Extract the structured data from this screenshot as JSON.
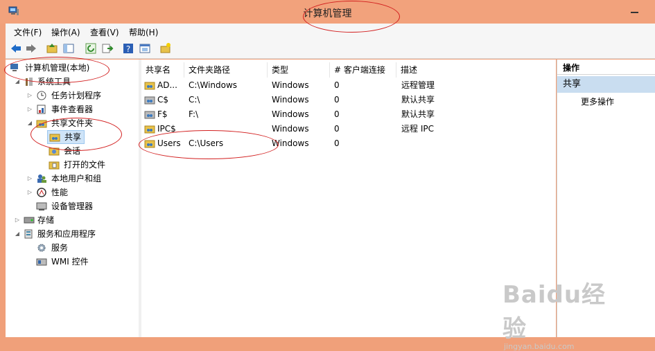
{
  "window": {
    "title": "计算机管理"
  },
  "menu": [
    "文件(F)",
    "操作(A)",
    "查看(V)",
    "帮助(H)"
  ],
  "toolbar_icons": [
    "back-arrow-icon",
    "forward-arrow-icon",
    "up-folder-icon",
    "show-hide-tree-icon",
    "refresh-icon",
    "export-list-icon",
    "help-icon",
    "properties-icon",
    "new-share-icon"
  ],
  "tree": {
    "root": "计算机管理(本地)",
    "system_tools": "系统工具",
    "task_scheduler": "任务计划程序",
    "event_viewer": "事件查看器",
    "shared_folders": "共享文件夹",
    "shares": "共享",
    "sessions": "会话",
    "open_files": "打开的文件",
    "local_users": "本地用户和组",
    "performance": "性能",
    "device_manager": "设备管理器",
    "storage": "存储",
    "services_apps": "服务和应用程序",
    "services": "服务",
    "wmi": "WMI 控件"
  },
  "list": {
    "columns": [
      "共享名",
      "文件夹路径",
      "类型",
      "# 客户端连接",
      "描述"
    ],
    "rows": [
      {
        "name": "AD...",
        "path": "C:\\Windows",
        "type": "Windows",
        "clients": "0",
        "desc": "远程管理"
      },
      {
        "name": "C$",
        "path": "C:\\",
        "type": "Windows",
        "clients": "0",
        "desc": "默认共享"
      },
      {
        "name": "F$",
        "path": "F:\\",
        "type": "Windows",
        "clients": "0",
        "desc": "默认共享"
      },
      {
        "name": "IPC$",
        "path": "",
        "type": "Windows",
        "clients": "0",
        "desc": "远程 IPC"
      },
      {
        "name": "Users",
        "path": "C:\\Users",
        "type": "Windows",
        "clients": "0",
        "desc": ""
      }
    ]
  },
  "actions": {
    "header": "操作",
    "section": "共享",
    "more": "更多操作"
  },
  "watermark": {
    "brand": "Baidu经验",
    "url": "jingyan.baidu.com"
  }
}
